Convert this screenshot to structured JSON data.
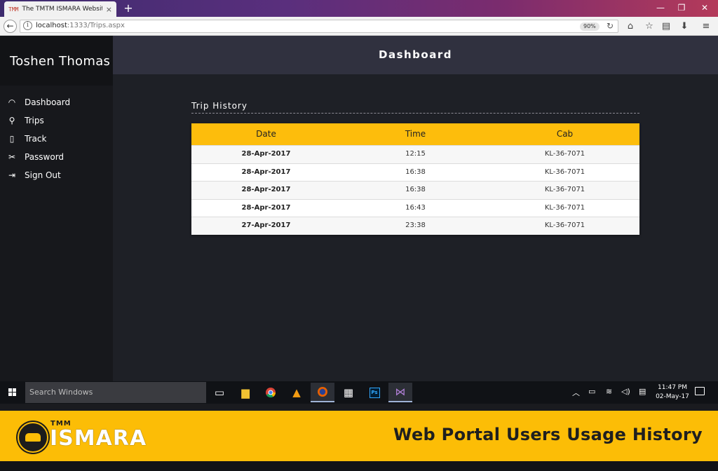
{
  "browser": {
    "tab_title": "The TMTM ISMARA Website",
    "tab_favicon": "TMM",
    "tab_close": "×",
    "new_tab": "+",
    "url_host": "localhost",
    "url_rest": ":1333/Trips.aspx",
    "zoom": "90%",
    "win_min": "—",
    "win_restore": "❐",
    "win_close": "✕"
  },
  "sidebar": {
    "user_name": "Toshen Thomas",
    "items": [
      {
        "label": "Dashboard",
        "icon": "gauge-icon",
        "glyph": "◠"
      },
      {
        "label": "Trips",
        "icon": "map-pin-icon",
        "glyph": "⚲"
      },
      {
        "label": "Track",
        "icon": "phone-icon",
        "glyph": "▯"
      },
      {
        "label": "Password",
        "icon": "tools-icon",
        "glyph": "✂"
      },
      {
        "label": "Sign Out",
        "icon": "sign-out-icon",
        "glyph": "⇥"
      }
    ]
  },
  "header": {
    "title": "Dashboard"
  },
  "trips": {
    "section_title": "Trip History",
    "columns": [
      "Date",
      "Time",
      "Cab"
    ],
    "rows": [
      {
        "date": "28-Apr-2017",
        "time": "12:15",
        "cab": "KL-36-7071"
      },
      {
        "date": "28-Apr-2017",
        "time": "16:38",
        "cab": "KL-36-7071"
      },
      {
        "date": "28-Apr-2017",
        "time": "16:38",
        "cab": "KL-36-7071"
      },
      {
        "date": "28-Apr-2017",
        "time": "16:43",
        "cab": "KL-36-7071"
      },
      {
        "date": "27-Apr-2017",
        "time": "23:38",
        "cab": "KL-36-7071"
      }
    ]
  },
  "taskbar": {
    "search_placeholder": "Search Windows",
    "time": "11:47 PM",
    "date": "02-May-17"
  },
  "banner": {
    "logo_small": "TMM",
    "logo_word": "ISMARA",
    "title": "Web Portal Users Usage History"
  },
  "colors": {
    "accent_yellow": "#fcbd06",
    "sidebar_bg": "#17181c",
    "header_bg": "#30313f",
    "main_bg": "#1e2026"
  }
}
